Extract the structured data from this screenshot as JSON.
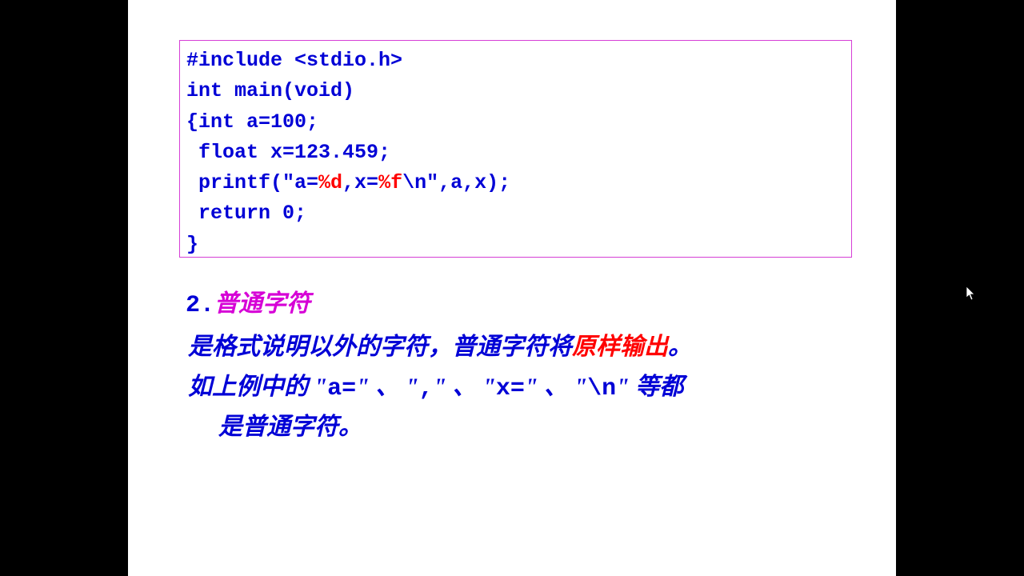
{
  "code": {
    "l1": "#include <stdio.h>",
    "l2": "int main(void)",
    "l3": "{int a=100;",
    "l4": " float x=123.459;",
    "l5a": " printf(\"a=",
    "l5fmt1": "%d",
    "l5b": ",x=",
    "l5fmt2": "%f",
    "l5c": "\\n\",a,x);",
    "l6": " return 0;",
    "l7": "}"
  },
  "heading": {
    "num": "2.",
    "text": "普通字符"
  },
  "para1": {
    "a": "是格式说明以外的字符，普通字符将",
    "red": "原样输出",
    "b": "。"
  },
  "para2": {
    "a": "如上例中的 \"",
    "m1": "a=",
    "b": "\" 、 \"",
    "m2": ",",
    "c": "\" 、 \"",
    "m3": "x=",
    "d": "\" 、 \"",
    "m4": "\\n",
    "e": "\" 等都",
    "f": "是普通字符。"
  }
}
